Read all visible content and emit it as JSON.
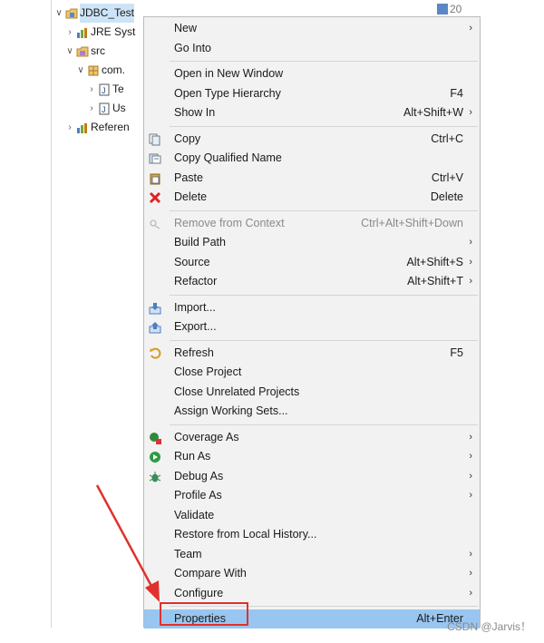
{
  "tree": {
    "items": [
      {
        "label": "JDBC_Test",
        "icon": "project-icon",
        "arrow": "∨",
        "indent": 0,
        "selected": true
      },
      {
        "label": "JRE Syst",
        "icon": "library-icon",
        "arrow": "›",
        "indent": 1
      },
      {
        "label": "src",
        "icon": "source-folder-icon",
        "arrow": "∨",
        "indent": 1
      },
      {
        "label": "com.",
        "icon": "package-icon",
        "arrow": "∨",
        "indent": 2
      },
      {
        "label": "Te",
        "icon": "java-file-icon",
        "arrow": "›",
        "indent": 3
      },
      {
        "label": "Us",
        "icon": "java-file-icon",
        "arrow": "›",
        "indent": 3
      },
      {
        "label": "Referen",
        "icon": "library-icon",
        "arrow": "›",
        "indent": 1
      }
    ]
  },
  "topright": {
    "text": "20"
  },
  "menu": {
    "items": [
      {
        "label": "New",
        "shortcut": "",
        "submenu": true
      },
      {
        "label": "Go Into",
        "shortcut": "",
        "submenu": false
      },
      {
        "sep": true
      },
      {
        "label": "Open in New Window",
        "shortcut": ""
      },
      {
        "label": "Open Type Hierarchy",
        "shortcut": "F4"
      },
      {
        "label": "Show In",
        "shortcut": "Alt+Shift+W",
        "submenu": true
      },
      {
        "sep": true
      },
      {
        "label": "Copy",
        "shortcut": "Ctrl+C",
        "icon": "copy-icon"
      },
      {
        "label": "Copy Qualified Name",
        "shortcut": "",
        "icon": "copy-qualified-icon"
      },
      {
        "label": "Paste",
        "shortcut": "Ctrl+V",
        "icon": "paste-icon"
      },
      {
        "label": "Delete",
        "shortcut": "Delete",
        "icon": "delete-icon"
      },
      {
        "sep": true
      },
      {
        "label": "Remove from Context",
        "shortcut": "Ctrl+Alt+Shift+Down",
        "icon": "remove-context-icon",
        "disabled": true
      },
      {
        "label": "Build Path",
        "shortcut": "",
        "submenu": true
      },
      {
        "label": "Source",
        "shortcut": "Alt+Shift+S",
        "submenu": true
      },
      {
        "label": "Refactor",
        "shortcut": "Alt+Shift+T",
        "submenu": true
      },
      {
        "sep": true
      },
      {
        "label": "Import...",
        "shortcut": "",
        "icon": "import-icon"
      },
      {
        "label": "Export...",
        "shortcut": "",
        "icon": "export-icon"
      },
      {
        "sep": true
      },
      {
        "label": "Refresh",
        "shortcut": "F5",
        "icon": "refresh-icon"
      },
      {
        "label": "Close Project",
        "shortcut": ""
      },
      {
        "label": "Close Unrelated Projects",
        "shortcut": ""
      },
      {
        "label": "Assign Working Sets...",
        "shortcut": ""
      },
      {
        "sep": true
      },
      {
        "label": "Coverage As",
        "shortcut": "",
        "submenu": true,
        "icon": "coverage-icon"
      },
      {
        "label": "Run As",
        "shortcut": "",
        "submenu": true,
        "icon": "run-icon"
      },
      {
        "label": "Debug As",
        "shortcut": "",
        "submenu": true,
        "icon": "debug-icon"
      },
      {
        "label": "Profile As",
        "shortcut": "",
        "submenu": true
      },
      {
        "label": "Validate",
        "shortcut": ""
      },
      {
        "label": "Restore from Local History...",
        "shortcut": ""
      },
      {
        "label": "Team",
        "shortcut": "",
        "submenu": true
      },
      {
        "label": "Compare With",
        "shortcut": "",
        "submenu": true
      },
      {
        "label": "Configure",
        "shortcut": "",
        "submenu": true
      },
      {
        "sep": true
      },
      {
        "label": "Properties",
        "shortcut": "Alt+Enter",
        "highlighted": true
      }
    ]
  },
  "watermark": "CSDN @Jarvis！",
  "colors": {
    "accent": "#99c6f0",
    "annotation": "#e0312d"
  }
}
